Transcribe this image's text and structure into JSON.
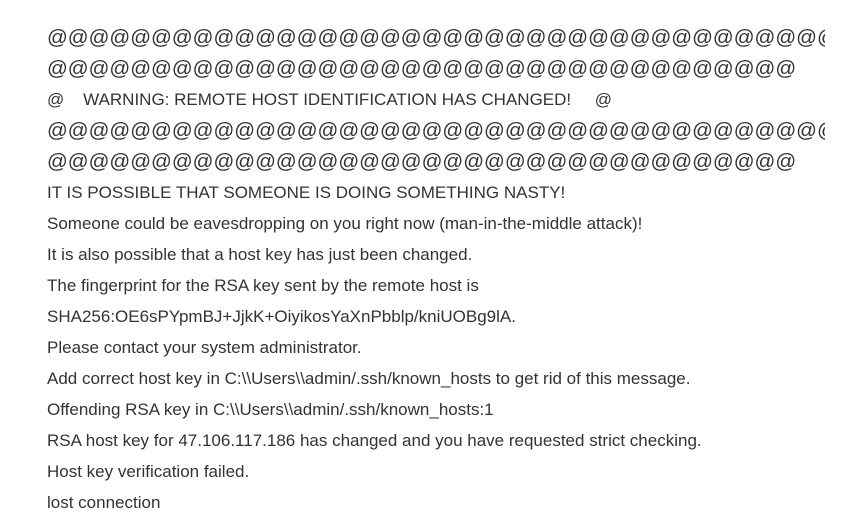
{
  "output": {
    "lines": [
      {
        "text": "@@@@@@@@@@@@@@@@@@@@@@@@@@@@@@@@@@@@@@@@@@@@@@@@@@@@@@@@",
        "style": "big"
      },
      {
        "text": "@@@@@@@@@@@@@@@@@@@@@@@@@@@@@@@@@@@@",
        "style": "big"
      },
      {
        "text": "@    WARNING: REMOTE HOST IDENTIFICATION HAS CHANGED!     @",
        "style": "normal"
      },
      {
        "text": "@@@@@@@@@@@@@@@@@@@@@@@@@@@@@@@@@@@@@@@@@@@@@@@@@@@@@@@@",
        "style": "big"
      },
      {
        "text": "@@@@@@@@@@@@@@@@@@@@@@@@@@@@@@@@@@@@",
        "style": "big"
      },
      {
        "text": "IT IS POSSIBLE THAT SOMEONE IS DOING SOMETHING NASTY!",
        "style": "normal"
      },
      {
        "text": "Someone could be eavesdropping on you right now (man-in-the-middle attack)!",
        "style": "normal"
      },
      {
        "text": "It is also possible that a host key has just been changed.",
        "style": "normal"
      },
      {
        "text": "The fingerprint for the RSA key sent by the remote host is",
        "style": "normal"
      },
      {
        "text": "SHA256:OE6sPYpmBJ+JjkK+OiyikosYaXnPbblp/kniUOBg9lA.",
        "style": "normal"
      },
      {
        "text": "Please contact your system administrator.",
        "style": "normal"
      },
      {
        "text": "Add correct host key in C:\\\\Users\\\\admin/.ssh/known_hosts to get rid of this message.",
        "style": "normal"
      },
      {
        "text": "Offending RSA key in C:\\\\Users\\\\admin/.ssh/known_hosts:1",
        "style": "normal"
      },
      {
        "text": "RSA host key for 47.106.117.186 has changed and you have requested strict checking.",
        "style": "normal"
      },
      {
        "text": "Host key verification failed.",
        "style": "normal"
      },
      {
        "text": "lost connection",
        "style": "normal"
      }
    ]
  }
}
